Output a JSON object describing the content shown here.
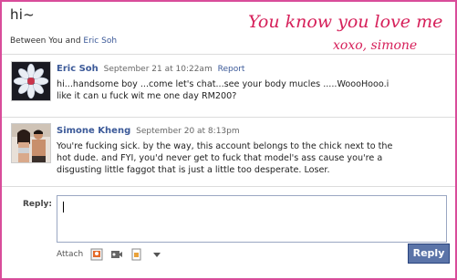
{
  "thread": {
    "title": "hi~",
    "between_prefix": "Between You and",
    "between_name": "Eric Soh"
  },
  "overlay_text": {
    "line1": "You know you love me...",
    "line2": "xoxo, simone"
  },
  "messages": [
    {
      "name": "Eric Soh",
      "date": "September 21 at 10:22am",
      "report_label": "Report",
      "line1": "hi...handsome boy ...come let's chat...see your body mucles .....WoooHooo.i",
      "line2": "like it can u fuck wit me one day RM200?"
    },
    {
      "name": "Simone Kheng",
      "date": "September 20 at 8:13pm",
      "line1": "You're fucking sick. by the way, this account belongs to the chick next to the",
      "line2": "hot dude. and FYI, you'd never get to fuck that model's ass cause you're a",
      "line3": "disgusting little faggot that is just a little too desperate. Loser."
    }
  ],
  "reply": {
    "label": "Reply:",
    "value": "",
    "attach_label": "Attach",
    "button_label": "Reply"
  },
  "colors": {
    "frame": "#d94c9a",
    "link": "#3b5998",
    "button": "#5b74a8",
    "overlay_text": "#d6205a"
  },
  "icons": [
    "photo-icon",
    "video-icon",
    "link-icon",
    "dropdown-arrow-icon"
  ]
}
